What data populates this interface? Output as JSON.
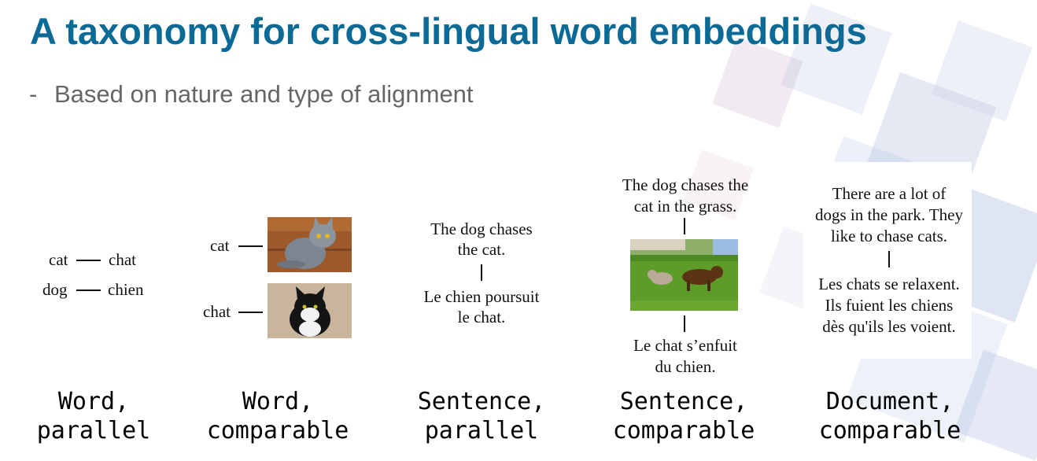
{
  "slide": {
    "title": "A taxonomy for cross-lingual word embeddings",
    "bullet_marker": "-",
    "bullet": "Based on nature and type of alignment"
  },
  "columns": [
    {
      "pairs": [
        {
          "source": "cat",
          "target": "chat"
        },
        {
          "source": "dog",
          "target": "chien"
        }
      ],
      "caption_line1": "Word,",
      "caption_line2": "parallel"
    },
    {
      "labels": [
        "cat",
        "chat"
      ],
      "images": [
        "grey-cat-photo",
        "black-white-cat-photo"
      ],
      "caption_line1": "Word,",
      "caption_line2": "comparable"
    },
    {
      "source_lines": [
        "The dog chases",
        "the cat."
      ],
      "target_lines": [
        "Le chien poursuit",
        "le chat."
      ],
      "caption_line1": "Sentence,",
      "caption_line2": "parallel"
    },
    {
      "source_lines": [
        "The dog chases the",
        "cat in the grass."
      ],
      "image": "dog-chasing-cat-photo",
      "target_lines": [
        "Le chat s’enfuit",
        "du chien."
      ],
      "caption_line1": "Sentence,",
      "caption_line2": "comparable"
    },
    {
      "source_lines": [
        "There are a lot of",
        "dogs in the park. They",
        "like to chase cats."
      ],
      "target_lines": [
        "Les chats se relaxent.",
        "Ils fuient les chiens",
        "dès qu'ils les voient."
      ],
      "caption_line1": "Document,",
      "caption_line2": "comparable"
    }
  ],
  "colors": {
    "title": "#0c6a96",
    "bullet": "#666666"
  }
}
